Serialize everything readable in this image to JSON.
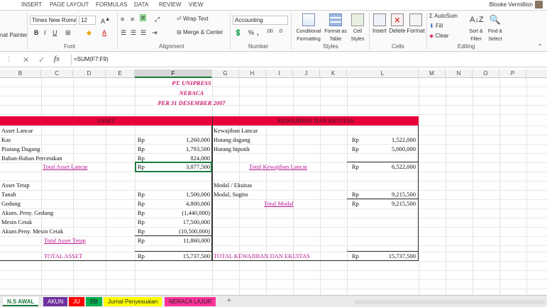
{
  "ribbon": {
    "tabs": [
      "INSERT",
      "PAGE LAYOUT",
      "FORMULAS",
      "DATA",
      "REVIEW",
      "VIEW"
    ],
    "user": "Blooke Vermillion",
    "painter_label": "nat Painter",
    "font_name": "Times New Roma",
    "font_size": "12",
    "wrap_text": "Wrap Text",
    "merge_center": "Merge & Center",
    "number_format": "Accounting",
    "cond_format": "Conditional Formatting",
    "format_table": "Format as Table",
    "cell_styles": "Cell Styles",
    "insert": "Insert",
    "delete": "Delete",
    "format": "Format",
    "autosum": "AutoSum",
    "fill": "Fill",
    "clear": "Clear",
    "sort_filter": "Sort & Filter",
    "find_select": "Find & Select",
    "groups": {
      "clipboard": "d",
      "font": "Font",
      "alignment": "Alignment",
      "number": "Number",
      "styles": "Styles",
      "cells": "Cells",
      "editing": "Editing"
    }
  },
  "formula_bar": {
    "fx": "fx",
    "formula": "=SUM(F7:F9)"
  },
  "columns": [
    "B",
    "C",
    "D",
    "E",
    "F",
    "G",
    "H",
    "I",
    "J",
    "K",
    "L",
    "M",
    "N",
    "O",
    "P"
  ],
  "sheet": {
    "company": "PT. UNIPRESS",
    "title": "NERACA",
    "date": "PER 31 DESEMBER 2007",
    "asset_header": "ASSET",
    "liab_header": "KEWAJIBAN DAN EKUITAS",
    "left": {
      "current_title": "Asset Lancar",
      "current": [
        {
          "label": "Kas",
          "cur": "Rp",
          "amount": "1,260,000"
        },
        {
          "label": "Piutang Dagang",
          "cur": "Rp",
          "amount": "1,793,500"
        },
        {
          "label": "Bahan-Bahan Percetakan",
          "cur": "Rp",
          "amount": "824,000"
        }
      ],
      "total_current": {
        "label": "Total Asset Lancar",
        "cur": "Rp",
        "amount": "3,877,500"
      },
      "fixed_title": "Asset Tetap",
      "fixed": [
        {
          "label": "Tanah",
          "cur": "Rp",
          "amount": "1,500,000"
        },
        {
          "label": "Gedung",
          "cur": "Rp",
          "amount": "4,800,000"
        },
        {
          "label": "Akum. Peny. Gedung",
          "cur": "Rp",
          "amount": "(1,440,000)"
        },
        {
          "label": "Mesin Cetak",
          "cur": "Rp",
          "amount": "17,500,000"
        },
        {
          "label": "Akum.Peny. Mesin Cetak",
          "cur": "Rp",
          "amount": "(10,500,000)"
        }
      ],
      "total_fixed": {
        "label": "Total Asset Tetap",
        "cur": "Rp",
        "amount": "11,860,000"
      },
      "total": {
        "label": "TOTAL ASSET",
        "cur": "Rp",
        "amount": "15,737,500"
      }
    },
    "right": {
      "current_title": "Kewajiban Lancar",
      "current": [
        {
          "label": "Hutang dagang",
          "cur": "Rp",
          "amount": "1,522,000"
        },
        {
          "label": "Hutang hipotik",
          "cur": "Rp",
          "amount": "5,000,000"
        }
      ],
      "total_current": {
        "label": "Total Kewajiban Lancar",
        "cur": "Rp",
        "amount": "6,522,000"
      },
      "equity_title": "Modal / Ekuitas",
      "equity": [
        {
          "label": "Modal, Sugito",
          "cur": "Rp",
          "amount": "9,215,500"
        }
      ],
      "total_equity": {
        "label": "Total Modal",
        "cur": "Rp",
        "amount": "9,215,500"
      },
      "total": {
        "label": "TOTAL KEWAJIBAN DAN EKUITAS",
        "cur": "Rp",
        "amount": "15,737,500"
      }
    }
  },
  "sheet_tabs": [
    {
      "label": "N.S AWAL",
      "color": "#ffffff"
    },
    {
      "label": "AKUN",
      "color": "#7030a0"
    },
    {
      "label": "JU",
      "color": "#ff0000"
    },
    {
      "label": "BB",
      "color": "#00b050"
    },
    {
      "label": "Jurnal Penyesuaian",
      "color": "#ffff00"
    },
    {
      "label": "NERACA LAJUR",
      "color": "#ff3399"
    }
  ],
  "add_sheet": "+"
}
